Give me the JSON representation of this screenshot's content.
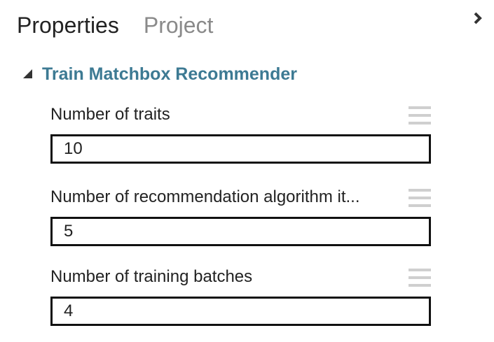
{
  "tabs": [
    {
      "label": "Properties",
      "active": true
    },
    {
      "label": "Project",
      "active": false
    }
  ],
  "collapse_icon": "chevron-right-icon",
  "section": {
    "title": "Train Matchbox Recommender",
    "expanded": true
  },
  "params": [
    {
      "label": "Number of traits",
      "value": "10"
    },
    {
      "label": "Number of recommendation algorithm it...",
      "value": "5"
    },
    {
      "label": "Number of training batches",
      "value": "4"
    }
  ],
  "colors": {
    "section_title": "#3d7a93",
    "active_tab": "#222222",
    "inactive_tab": "#8a8a8a",
    "input_border": "#111111",
    "menu_icon": "#cfcfcf"
  }
}
